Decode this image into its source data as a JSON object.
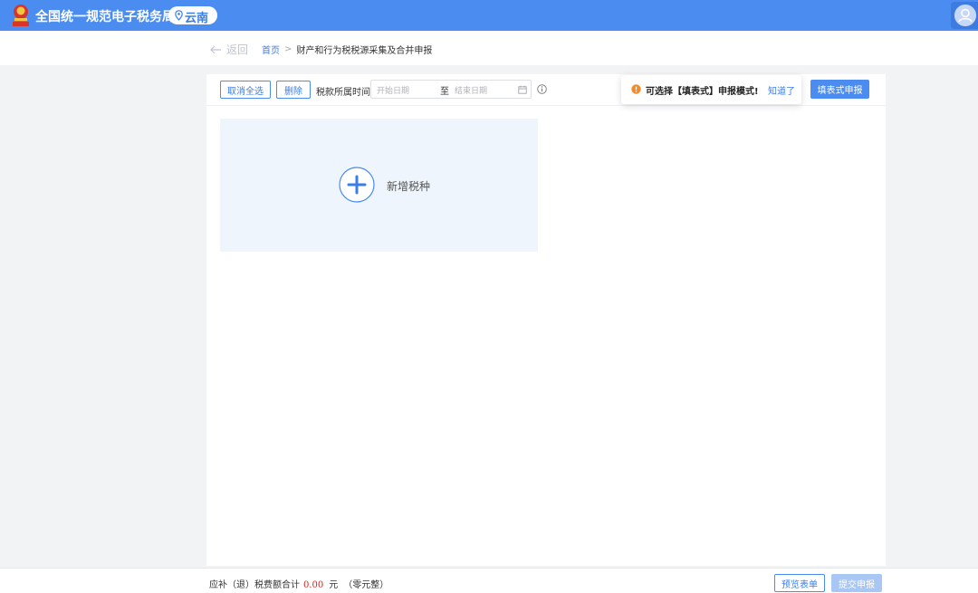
{
  "header": {
    "site_title": "全国统一规范电子税务局",
    "region": "云南",
    "brand_color": "#4a8cf0",
    "icons": [
      "emblem-icon",
      "location-pin-icon",
      "user-avatar-icon"
    ]
  },
  "breadcrumb": {
    "back_label": "返回",
    "home": "首页",
    "separator": ">",
    "current": "财产和行为税税源采集及合并申报"
  },
  "toolbar": {
    "deselect_all": "取消全选",
    "delete": "删除",
    "period_label": "税款所属时间",
    "date_start_placeholder": "开始日期",
    "date_separator": "至",
    "date_end_placeholder": "结束日期",
    "form_declare": "填表式申报"
  },
  "tooltip": {
    "message": "可选择【填表式】申报模式!",
    "ack": "知道了"
  },
  "add_tile": {
    "label": "新增税种"
  },
  "footer": {
    "total_label": "应补（退）税费额合计",
    "amount": "0.00",
    "unit": "元",
    "amount_words": "（零元整）",
    "preview": "预览表单",
    "submit": "提交申报",
    "amount_color": "#e02020"
  }
}
